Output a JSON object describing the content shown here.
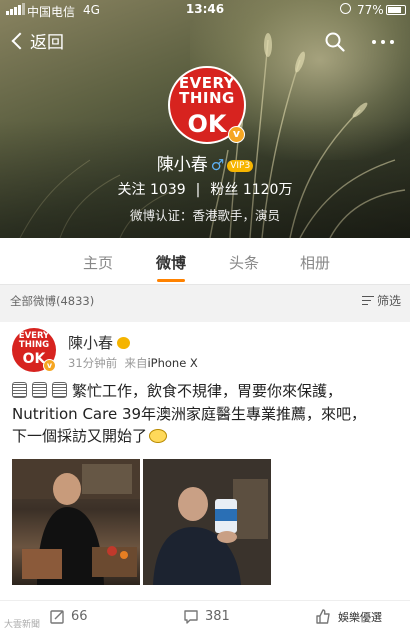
{
  "status_bar": {
    "carrier": "中国电信",
    "network": "4G",
    "time": "13:46",
    "battery": "77%"
  },
  "nav": {
    "back_label": "返回"
  },
  "profile": {
    "avatar_text": [
      "EVERY",
      "THING",
      "OK"
    ],
    "name": "陳小春",
    "gender_symbol": "♂",
    "vip_badge": "VIP3",
    "following_label": "关注",
    "following_count": "1039",
    "followers_label": "粉丝",
    "followers_count": "1120万",
    "certification": "微博认证：香港歌手，演员"
  },
  "tabs": [
    {
      "label": "主页",
      "active": false
    },
    {
      "label": "微博",
      "active": true
    },
    {
      "label": "头条",
      "active": false
    },
    {
      "label": "相册",
      "active": false
    }
  ],
  "filter_bar": {
    "count_text": "全部微博(4833)",
    "filter_label": "筛选"
  },
  "post": {
    "author": "陳小春",
    "time": "31分钟前",
    "source_prefix": "来自",
    "source": "iPhone X",
    "text_line1": "繁忙工作，飲食不規律，胃要你來保護，",
    "text_line2": "Nutrition Care 39年澳洲家庭醫生專業推薦，來吧，",
    "text_line3": "下一個採訪又開始了",
    "reposts": "66",
    "comments": "381",
    "watermark_left": "大雲新聞",
    "watermark_right": "娛樂優選"
  },
  "colors": {
    "accent": "#ff8200",
    "brand_red": "#d7231f",
    "verify": "#f5a623"
  }
}
